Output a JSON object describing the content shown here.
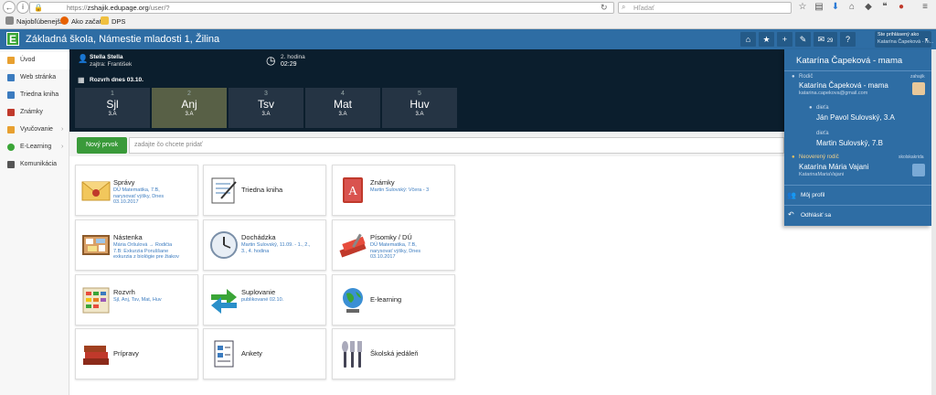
{
  "browser": {
    "url": "https://zshajik.edupage.org/user/?",
    "url_host": "zshajik.edupage.org",
    "url_prefix": "https://",
    "url_suffix": "/user/?",
    "search_placeholder": "Hľadať",
    "bookmarks": [
      "Najobľúbenejšie",
      "Ako začať",
      "DPS"
    ]
  },
  "header": {
    "logo_letter": "E",
    "school_name": "Základná škola, Námestie mladosti 1, Žilina",
    "messages_count": "29",
    "user_box_line1": "Ste prihlásený ako",
    "user_box_line2": "Katarína Čapeková - m..."
  },
  "sidebar": {
    "items": [
      {
        "label": "Úvod",
        "icon": "home-icon",
        "color": "#e8a030"
      },
      {
        "label": "Web stránka",
        "icon": "web-icon",
        "color": "#3b7bbf"
      },
      {
        "label": "Triedna kniha",
        "icon": "book-icon",
        "color": "#3b7bbf"
      },
      {
        "label": "Známky",
        "icon": "grades-icon",
        "color": "#c0392b"
      },
      {
        "label": "Vyučovanie",
        "icon": "teaching-icon",
        "color": "#e8a030"
      },
      {
        "label": "E-Learning",
        "icon": "globe-icon",
        "color": "#3aa537"
      },
      {
        "label": "Komunikácia",
        "icon": "chat-icon",
        "color": "#555555"
      }
    ]
  },
  "timetable": {
    "teacher_name": "Stella Stella",
    "teacher_sub": "zajtra: František",
    "hour_label": "2. hodina",
    "hour_time": "02:29",
    "schedule_title": "Rozvrh dnes 03.10.",
    "lessons": [
      {
        "num": "1",
        "subject": "Sjl",
        "class": "3.A"
      },
      {
        "num": "2",
        "subject": "Anj",
        "class": "3.A"
      },
      {
        "num": "3",
        "subject": "Tsv",
        "class": "3.A"
      },
      {
        "num": "4",
        "subject": "Mat",
        "class": "3.A"
      },
      {
        "num": "5",
        "subject": "Huv",
        "class": "3.A"
      }
    ]
  },
  "post": {
    "new_button": "Nový prvok",
    "placeholder": "zadajte čo chcete pridať"
  },
  "tiles": [
    {
      "title": "Správy",
      "sub": [
        "DÚ Matematika, 7.B,",
        "narysovať výšky, Dnes",
        "03.10.2017"
      ],
      "icon": "envelope-icon"
    },
    {
      "title": "Triedna kniha",
      "sub": [],
      "icon": "notebook-icon"
    },
    {
      "title": "Známky",
      "sub": [
        "Martin Sulovský: Včera - 3"
      ],
      "icon": "grades-book-icon"
    },
    {
      "title": "Nástenka",
      "sub": [
        "Mária Oršulová → Rodičia",
        "7.B: Exkurzia Poruššane",
        "exkurzia z biológie pre žiakov"
      ],
      "icon": "noticeboard-icon"
    },
    {
      "title": "Dochádzka",
      "sub": [
        "Martin Sulovský, 11.09. - 1., 2.,",
        "3., 4. hodina"
      ],
      "icon": "clock-icon"
    },
    {
      "title": "Písomky / DÚ",
      "sub": [
        "DÚ Matematika, 7.B,",
        "narysovať výšky, Dnes",
        "03.10.2017"
      ],
      "icon": "homework-icon"
    },
    {
      "title": "Rozvrh",
      "sub": [
        "Sjl, Anj, Tsv, Mat, Huv"
      ],
      "icon": "timetable-icon"
    },
    {
      "title": "Suplovanie",
      "sub": [
        "publikované 02.10."
      ],
      "icon": "substitution-arrows-icon"
    },
    {
      "title": "E-learning",
      "sub": [],
      "icon": "globe-icon"
    },
    {
      "title": "Prípravy",
      "sub": [],
      "icon": "books-icon"
    },
    {
      "title": "Ankety",
      "sub": [],
      "icon": "survey-icon"
    },
    {
      "title": "Školská jedáleň",
      "sub": [],
      "icon": "cutlery-icon"
    }
  ],
  "panel": {
    "title": "Katarína Čapeková - mama",
    "parent_role": "Rodič",
    "parent_switch": "zahajik",
    "parent_name": "Katarína Čapeková - mama",
    "parent_email": "katarina.capekova@gmail.com",
    "child_role_1": "dieťa",
    "child_name_1": "Ján Pavol Sulovský, 3.A",
    "child_role_2": "dieťa",
    "child_name_2": "Martin Sulovský, 7.B",
    "second_role": "Neoverený rodič",
    "second_switch": "skolskakrida",
    "second_name": "Katarína Mária Vajani",
    "second_login": "KatarinaMariaVajani",
    "my_profile": "Môj profil",
    "logout": "Odhlásiť sa"
  },
  "colors": {
    "app_blue": "#2e6da4",
    "dark_bg": "#0b1e2d",
    "new_green": "#3a9a3a",
    "link_blue": "#3b7bbf"
  }
}
